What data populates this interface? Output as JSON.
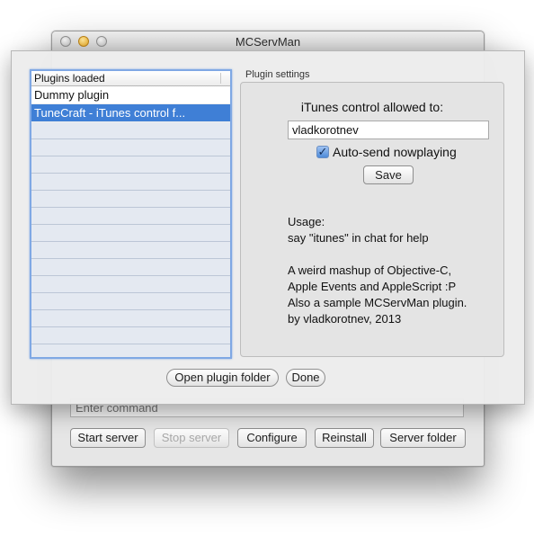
{
  "window": {
    "title": "MCServMan",
    "command_placeholder": "Enter command",
    "buttons": {
      "start": "Start server",
      "stop": "Stop server",
      "configure": "Configure",
      "reinstall": "Reinstall",
      "server_folder": "Server folder"
    }
  },
  "plugins": {
    "header": "Plugins loaded",
    "items": [
      {
        "label": "Dummy plugin",
        "selected": false
      },
      {
        "label": "TuneCraft - iTunes control f...",
        "selected": true
      }
    ]
  },
  "settings": {
    "group_label": "Plugin settings",
    "itunes_label": "iTunes control allowed to:",
    "username_value": "vladkorotnev",
    "checkbox_label": "Auto-send nowplaying",
    "checkbox_checked": true,
    "save_label": "Save",
    "usage_lines": [
      "Usage:",
      "say \"itunes\" in chat for help",
      "",
      "A weird mashup of Objective-C,",
      "Apple Events and AppleScript :P",
      "Also a sample MCServMan plugin.",
      "by vladkorotnev, 2013"
    ]
  },
  "sheet_buttons": {
    "open_folder": "Open plugin folder",
    "done": "Done"
  },
  "colors": {
    "selection": "#3f7fd6",
    "focus_ring": "#7fa8e4"
  }
}
